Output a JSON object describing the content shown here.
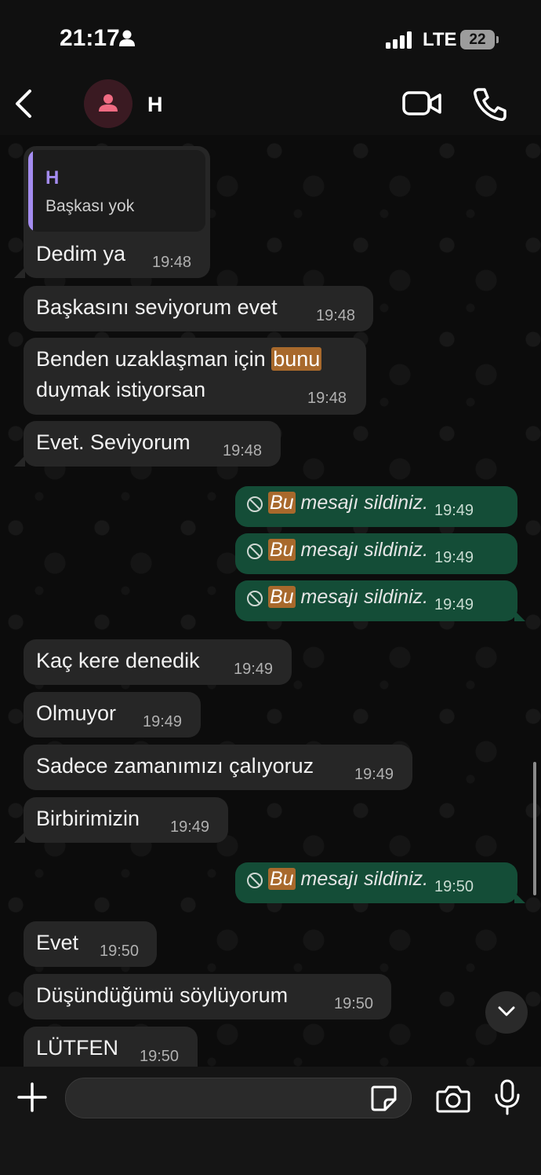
{
  "status_bar": {
    "time": "21:17",
    "network": "LTE",
    "battery": "22"
  },
  "header": {
    "contact_name": "H",
    "avatar_icon": "person-icon"
  },
  "quoted_reply": {
    "author": "H",
    "text": "Başkası yok"
  },
  "messages": [
    {
      "dir": "in",
      "text": "Dedim ya",
      "time": "19:48"
    },
    {
      "dir": "in",
      "text": "Başkasını seviyorum evet",
      "time": "19:48"
    },
    {
      "dir": "in",
      "text_before": "Benden uzaklaşman için ",
      "highlight": "bunu",
      "text_line2": "duymak istiyorsan",
      "time": "19:48"
    },
    {
      "dir": "in",
      "text": "Evet. Seviyorum",
      "time": "19:48"
    },
    {
      "dir": "out",
      "deleted": true,
      "highlight": "Bu",
      "text": " mesajı sildiniz.",
      "time": "19:49"
    },
    {
      "dir": "out",
      "deleted": true,
      "highlight": "Bu",
      "text": " mesajı sildiniz.",
      "time": "19:49"
    },
    {
      "dir": "out",
      "deleted": true,
      "highlight": "Bu",
      "text": " mesajı sildiniz.",
      "time": "19:49"
    },
    {
      "dir": "in",
      "text": "Kaç kere denedik",
      "time": "19:49"
    },
    {
      "dir": "in",
      "text": "Olmuyor",
      "time": "19:49"
    },
    {
      "dir": "in",
      "text": "Sadece zamanımızı çalıyoruz",
      "time": "19:49"
    },
    {
      "dir": "in",
      "text": "Birbirimizin",
      "time": "19:49"
    },
    {
      "dir": "out",
      "deleted": true,
      "highlight": "Bu",
      "text": " mesajı sildiniz.",
      "time": "19:50"
    },
    {
      "dir": "in",
      "text": "Evet",
      "time": "19:50"
    },
    {
      "dir": "in",
      "text": "Düşündüğümü söylüyorum",
      "time": "19:50"
    },
    {
      "dir": "in",
      "text": "LÜTFEN",
      "time": "19:50"
    }
  ],
  "composer": {
    "placeholder": ""
  },
  "colors": {
    "incoming_bubble": "#262626",
    "outgoing_bubble": "#144d37",
    "highlight": "#a8692c",
    "quote_accent": "#a48cf0"
  }
}
